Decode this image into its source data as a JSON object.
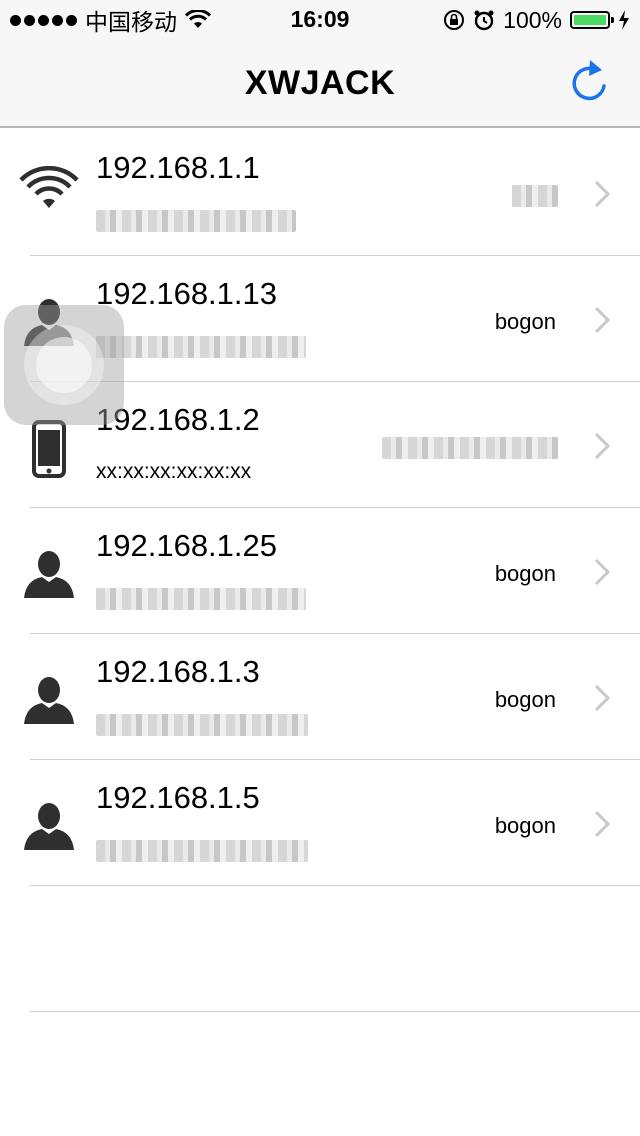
{
  "status_bar": {
    "carrier": "中国移动",
    "time": "16:09",
    "battery": "100%"
  },
  "nav": {
    "title": "XWJACK"
  },
  "devices": [
    {
      "ip": "192.168.1.1",
      "icon": "wifi-icon",
      "name": "",
      "mac": ""
    },
    {
      "ip": "192.168.1.13",
      "icon": "person-icon",
      "name": "bogon",
      "mac": ""
    },
    {
      "ip": "192.168.1.2",
      "icon": "phone-icon",
      "name": "",
      "mac": "xx:xx:xx:xx:xx:xx"
    },
    {
      "ip": "192.168.1.25",
      "icon": "person-icon",
      "name": "bogon",
      "mac": ""
    },
    {
      "ip": "192.168.1.3",
      "icon": "person-icon",
      "name": "bogon",
      "mac": ""
    },
    {
      "ip": "192.168.1.5",
      "icon": "person-icon",
      "name": "bogon",
      "mac": ""
    }
  ],
  "colors": {
    "accent": "#1a73e8",
    "battery": "#4cd964",
    "separator": "#d0d0d0"
  }
}
